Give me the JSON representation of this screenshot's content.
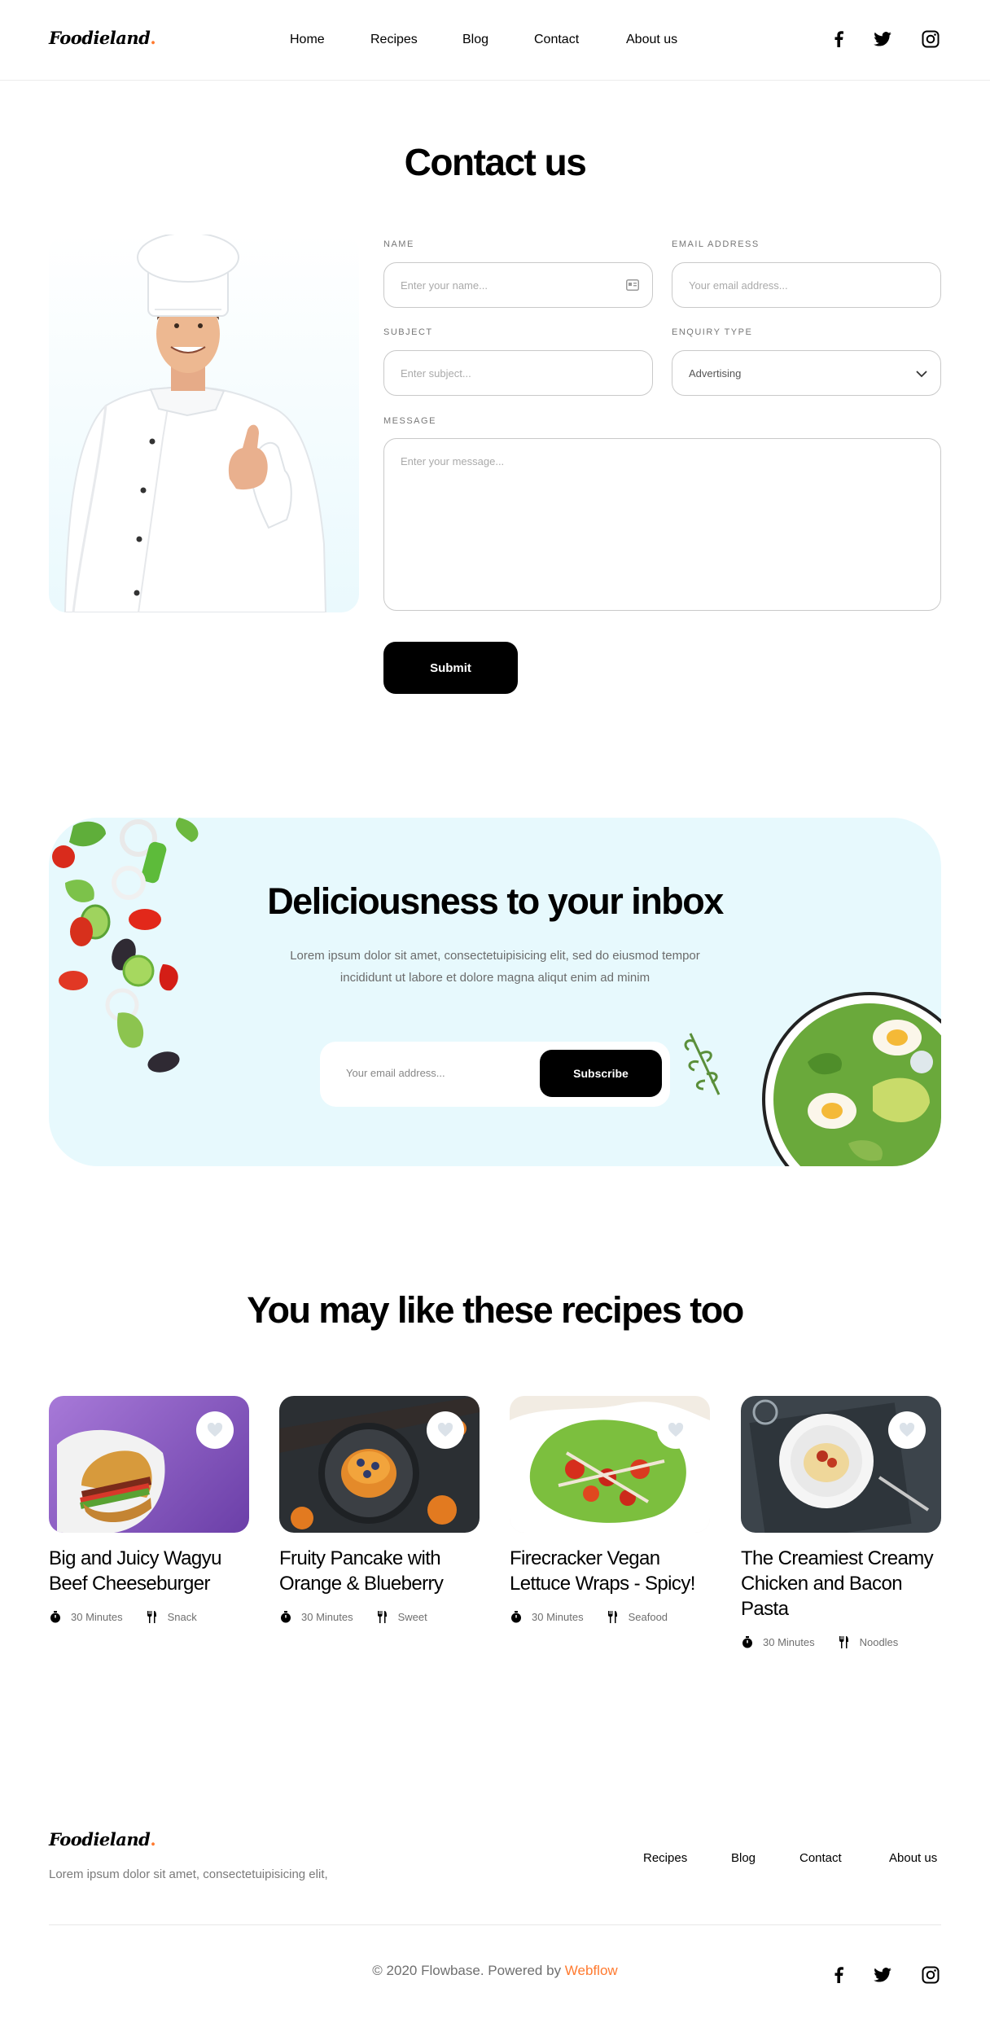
{
  "header": {
    "logo": "Foodieland",
    "logo_dot": ".",
    "nav": [
      "Home",
      "Recipes",
      "Blog",
      "Contact",
      "About us"
    ],
    "social_icons": [
      "facebook-icon",
      "twitter-icon",
      "instagram-icon"
    ]
  },
  "contact": {
    "title": "Contact us",
    "name_label": "NAME",
    "name_placeholder": "Enter your name...",
    "email_label": "EMAIL ADDRESS",
    "email_placeholder": "Your email address...",
    "subject_label": "SUBJECT",
    "subject_placeholder": "Enter subject...",
    "enquiry_label": "ENQUIRY TYPE",
    "enquiry_value": "Advertising",
    "message_label": "MESSAGE",
    "message_placeholder": "Enter your message...",
    "submit": "Submit"
  },
  "newsletter": {
    "title": "Deliciousness to your inbox",
    "description": "Lorem ipsum dolor sit amet, consectetuipisicing elit, sed do eiusmod tempor incididunt ut labore et dolore magna aliqut enim ad minim",
    "email_placeholder": "Your email address...",
    "subscribe": "Subscribe"
  },
  "recipes": {
    "title": "You may like these recipes too",
    "items": [
      {
        "title": "Big and Juicy Wagyu Beef Cheeseburger",
        "time": "30 Minutes",
        "category": "Snack"
      },
      {
        "title": "Fruity Pancake with Orange & Blueberry",
        "time": "30 Minutes",
        "category": "Sweet"
      },
      {
        "title": "Firecracker Vegan Lettuce Wraps - Spicy!",
        "time": "30 Minutes",
        "category": "Seafood"
      },
      {
        "title": "The Creamiest Creamy Chicken and Bacon Pasta",
        "time": "30 Minutes",
        "category": "Noodles"
      }
    ]
  },
  "footer": {
    "logo": "Foodieland",
    "logo_dot": ".",
    "description": "Lorem ipsum dolor sit amet, consectetuipisicing elit,",
    "nav": [
      "Recipes",
      "Blog",
      "Contact",
      "About us"
    ],
    "copyright_prefix": "© 2020 Flowbase. Powered by ",
    "copyright_link": "Webflow"
  },
  "colors": {
    "accent": "#ff7a2f",
    "newsletter_bg": "#e7f9fd",
    "button": "#000000"
  }
}
